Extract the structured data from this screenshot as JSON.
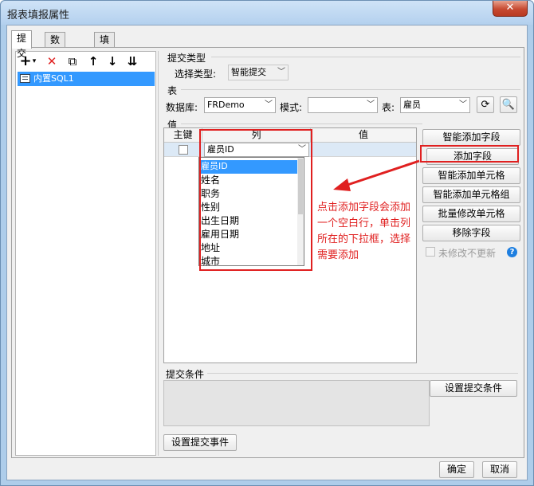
{
  "window": {
    "title": "报表填报属性",
    "close_label": "✕"
  },
  "tabs": [
    {
      "label": "提交"
    },
    {
      "label": "数据校验"
    },
    {
      "label": "填报快捷键设置"
    }
  ],
  "toolbar": {
    "add": "+",
    "add_arrow": "▾",
    "delete": "✕",
    "copy": "⧉",
    "up": "↑",
    "down": "↓",
    "bottom": "⇊"
  },
  "tree": {
    "items": [
      {
        "label": "内置SQL1"
      }
    ]
  },
  "submit_type": {
    "group": "提交类型",
    "label": "选择类型:",
    "value": "智能提交"
  },
  "table_section": {
    "group": "表",
    "db_label": "数据库:",
    "db_value": "FRDemo",
    "schema_label": "模式:",
    "schema_value": "",
    "table_label": "表:",
    "table_value": "雇员"
  },
  "values_section": {
    "group": "值",
    "headers": [
      "主键",
      "列",
      "值"
    ],
    "row": {
      "column_value": "雇员ID"
    }
  },
  "dropdown": {
    "options": [
      "雇员ID",
      "姓名",
      "职务",
      "性别",
      "出生日期",
      "雇用日期",
      "地址",
      "城市"
    ]
  },
  "side_buttons": {
    "smart_add_field": "智能添加字段",
    "add_field": "添加字段",
    "smart_add_cell": "智能添加单元格",
    "smart_add_cell_group": "智能添加单元格组",
    "batch_modify_cell": "批量修改单元格",
    "remove_field": "移除字段",
    "no_update_unchanged": "未修改不更新",
    "help": "?"
  },
  "annotation": {
    "text": "点击添加字段会添加一个空白行，单击列所在的下拉框，选择需要添加"
  },
  "condition": {
    "group": "提交条件",
    "set_condition": "设置提交条件",
    "set_event": "设置提交事件"
  },
  "footer": {
    "ok": "确定",
    "cancel": "取消"
  },
  "colors": {
    "selection": "#3399ff",
    "annotation_red": "#e02020",
    "title_bar": "#b3d0ee"
  }
}
